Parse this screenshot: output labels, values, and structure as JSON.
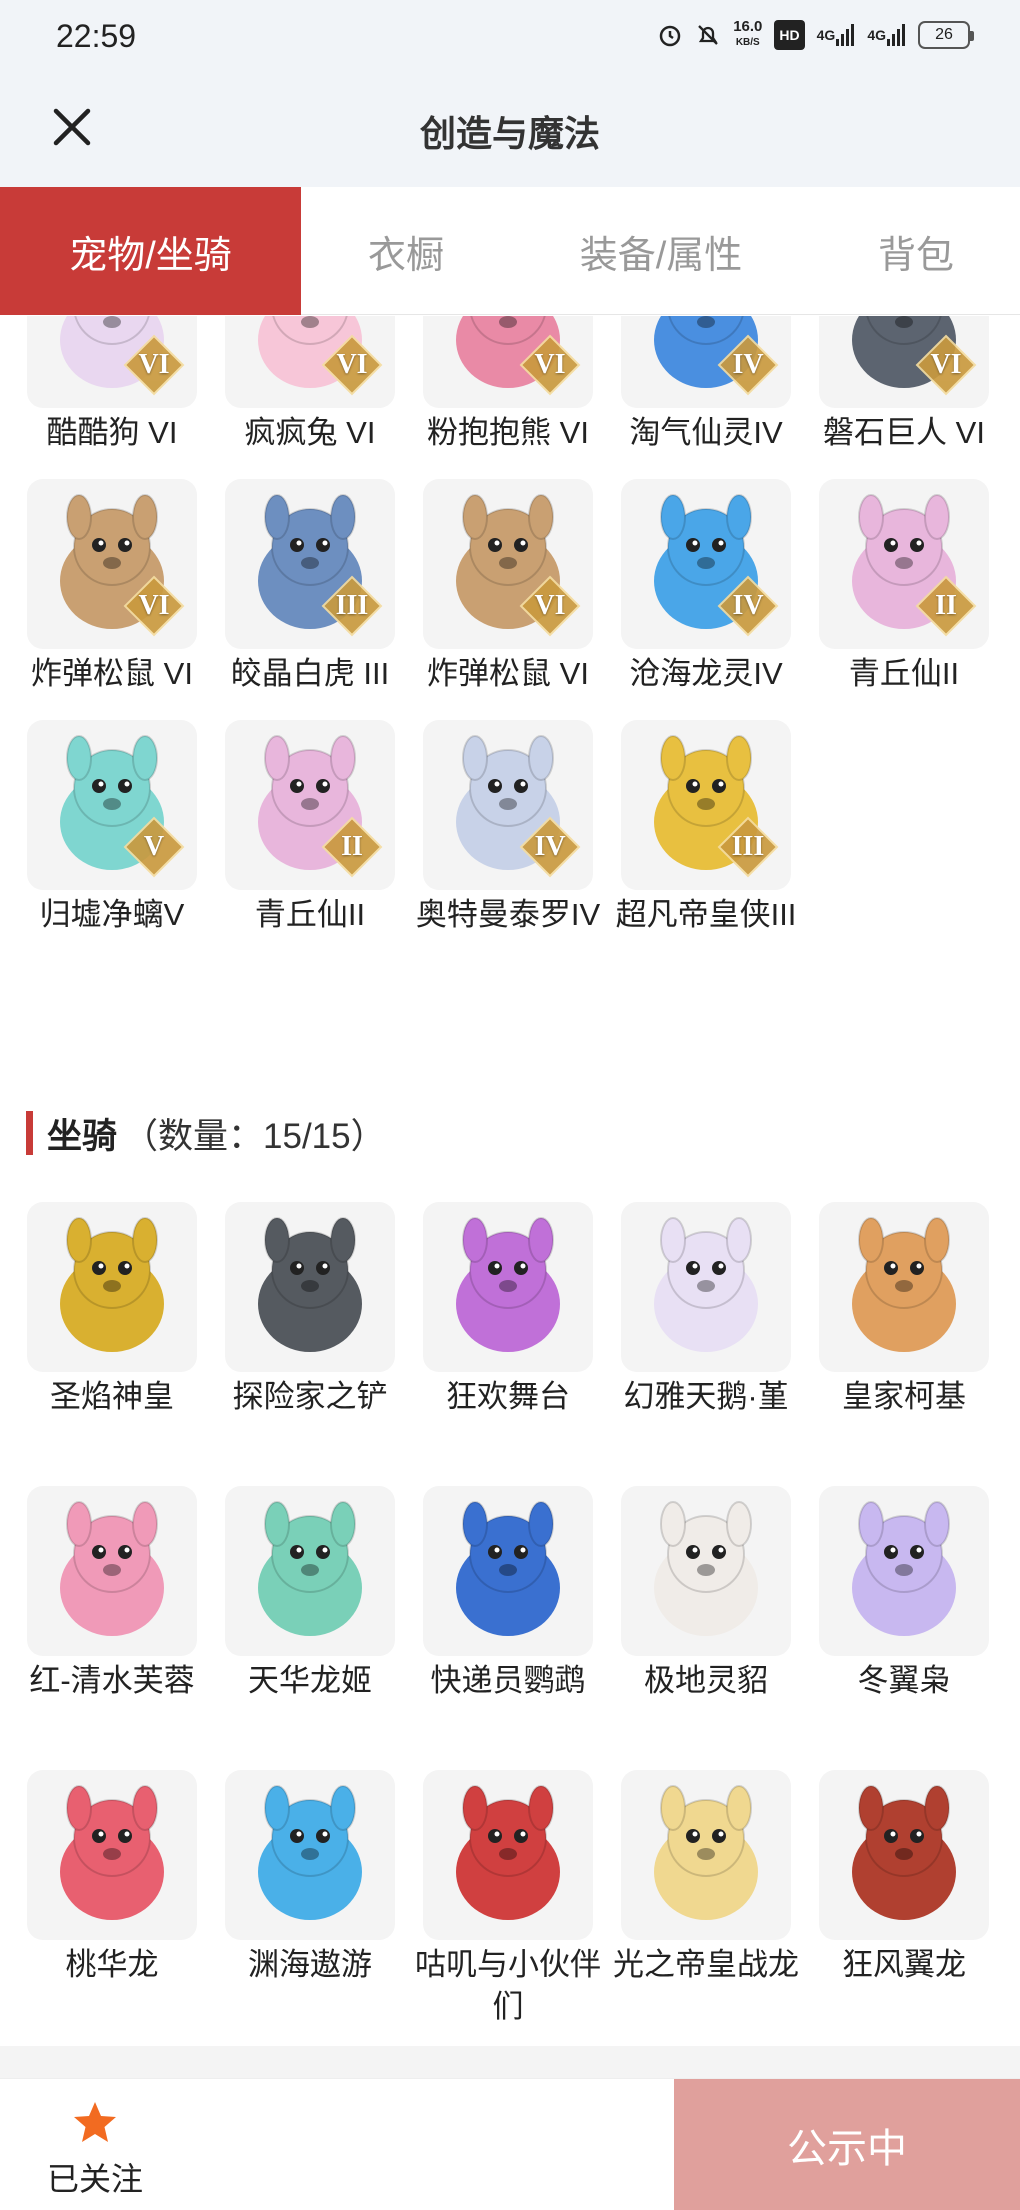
{
  "status_bar": {
    "time": "22:59",
    "speed_value": "16.0",
    "speed_unit": "KB/S",
    "hd": "HD",
    "net1": "4G",
    "net2": "4G",
    "battery": "26"
  },
  "header": {
    "title": "创造与魔法"
  },
  "tabs": [
    {
      "label": "宠物/坐骑",
      "active": true
    },
    {
      "label": "衣橱",
      "active": false
    },
    {
      "label": "装备/属性",
      "active": false
    },
    {
      "label": "背包",
      "active": false
    }
  ],
  "pets": [
    {
      "name": "酷酷狗 VI",
      "rank": "VI",
      "color": "#e9d7f0"
    },
    {
      "name": "疯疯兔 VI",
      "rank": "VI",
      "color": "#f7c6d8"
    },
    {
      "name": "粉抱抱熊 VI",
      "rank": "VI",
      "color": "#e98aa6"
    },
    {
      "name": "淘气仙灵IV",
      "rank": "IV",
      "color": "#4a8fe0"
    },
    {
      "name": "磐石巨人 VI",
      "rank": "VI",
      "color": "#5c6470"
    },
    {
      "name": "炸弹松鼠 VI",
      "rank": "VI",
      "color": "#c9a072"
    },
    {
      "name": "皎晶白虎 III",
      "rank": "III",
      "color": "#6d8fc0"
    },
    {
      "name": "炸弹松鼠 VI",
      "rank": "VI",
      "color": "#c9a072"
    },
    {
      "name": "沧海龙灵IV",
      "rank": "IV",
      "color": "#4aa6e8"
    },
    {
      "name": "青丘仙II",
      "rank": "II",
      "color": "#e8b6dc"
    },
    {
      "name": "归墟净螭V",
      "rank": "V",
      "color": "#7fd6d0"
    },
    {
      "name": "青丘仙II",
      "rank": "II",
      "color": "#e8b6dc"
    },
    {
      "name": "奥特曼泰罗IV",
      "rank": "IV",
      "color": "#c8d2e8"
    },
    {
      "name": "超凡帝皇侠III",
      "rank": "III",
      "color": "#e8c040"
    }
  ],
  "mounts_section": {
    "title": "坐骑",
    "count": "（数量：15/15）"
  },
  "mounts": [
    {
      "name": "圣焰神皇",
      "color": "#d9b030"
    },
    {
      "name": "探险家之铲",
      "color": "#555a60"
    },
    {
      "name": "狂欢舞台",
      "color": "#c070d8"
    },
    {
      "name": "幻雅天鹅·堇",
      "color": "#e8e0f4"
    },
    {
      "name": "皇家柯基",
      "color": "#e0a060"
    },
    {
      "name": "红-清水芙蓉",
      "color": "#f09ab8"
    },
    {
      "name": "天华龙姬",
      "color": "#7ad0b8"
    },
    {
      "name": "快递员鹦鹉",
      "color": "#3a70d0"
    },
    {
      "name": "极地灵貂",
      "color": "#f0ece8"
    },
    {
      "name": "冬翼枭",
      "color": "#c8b8f0"
    },
    {
      "name": "桃华龙",
      "color": "#e86070"
    },
    {
      "name": "渊海遨游",
      "color": "#4ab0e8"
    },
    {
      "name": "咕叽与小伙伴们",
      "color": "#d04040"
    },
    {
      "name": "光之帝皇战龙",
      "color": "#f0d890"
    },
    {
      "name": "狂风翼龙",
      "color": "#b04030"
    }
  ],
  "footer": {
    "follow_label": "已关注",
    "public_button": "公示中"
  },
  "colors": {
    "accent": "#c83b38",
    "public_button": "#e0a09c",
    "star": "#f26b21",
    "rank_badge": "#c99a3e"
  }
}
